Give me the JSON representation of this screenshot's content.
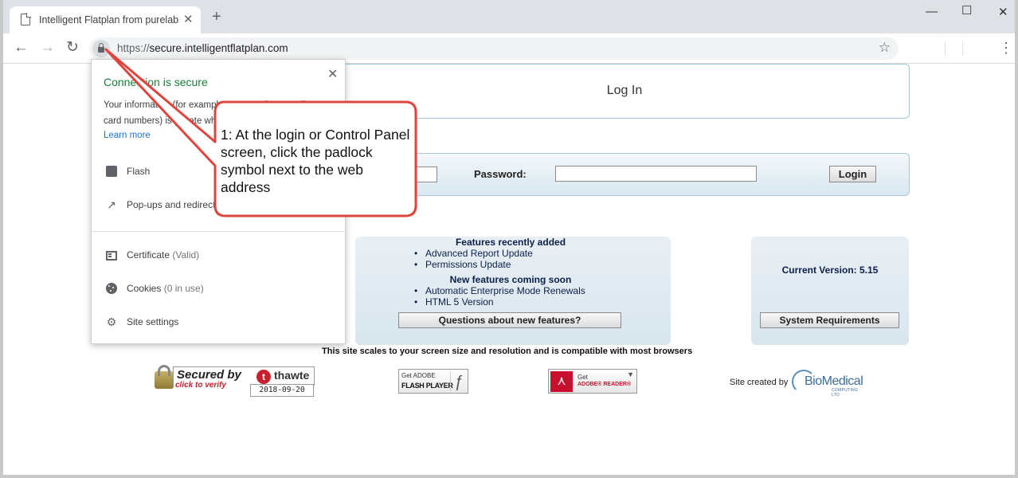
{
  "browser": {
    "tab_title": "Intelligent Flatplan from purelabs",
    "tab_close": "✕",
    "new_tab": "+",
    "window_controls": {
      "minimize": "—",
      "maximize": "☐",
      "close": "✕"
    },
    "nav": {
      "back": "←",
      "forward": "→",
      "reload": "↻"
    },
    "url_scheme": "https://",
    "url_host": "secure.intelligentflatplan.com",
    "bookmark_star": "☆",
    "menu": "⋮"
  },
  "popup": {
    "title": "Connection is secure",
    "close": "✕",
    "description": "Your information (for example, passwords or credit card numbers) is private when it is sent to this site.",
    "learn_more": "Learn more",
    "rows": [
      {
        "label": "Flash",
        "icon": "puzzle-icon"
      },
      {
        "label": "Pop-ups and redirects",
        "icon": "external-link-icon"
      }
    ],
    "certificate": {
      "label": "Certificate",
      "status": "(Valid)"
    },
    "cookies": {
      "label": "Cookies",
      "status": "(0 in use)"
    },
    "site_settings": "Site settings"
  },
  "page": {
    "login_title": "Log In",
    "password_label": "Password:",
    "login_button": "Login",
    "features": {
      "recent_heading": "Features recently added",
      "recent_items": [
        "Advanced Report Update",
        "Permissions Update"
      ],
      "upcoming_heading": "New features coming soon",
      "upcoming_items": [
        "Automatic Enterprise Mode Renewals",
        "HTML 5 Version"
      ],
      "questions_button": "Questions about new features?"
    },
    "version": {
      "label": "Current Version: 5.15",
      "requirements_button": "System Requirements"
    },
    "scale_note": "This site scales to your screen size and resolution and is compatible with most browsers"
  },
  "badges": {
    "thawte": {
      "secured_by": "Secured by",
      "brand": "thawte",
      "verify": "click to verify",
      "date": "2018-09-20"
    },
    "flash": {
      "get": "Get ADOBE",
      "name": "FLASH PLAYER"
    },
    "reader": {
      "get": "Get",
      "name": "ADOBE® READER®"
    },
    "site_created": "Site created by",
    "biomedical": {
      "name": "BioMedical",
      "sub": "COMPUTING LTD"
    }
  },
  "callout": {
    "text": "1: At the login or Control Panel screen, click the padlock symbol next to the web address",
    "color": "#e0443e"
  }
}
